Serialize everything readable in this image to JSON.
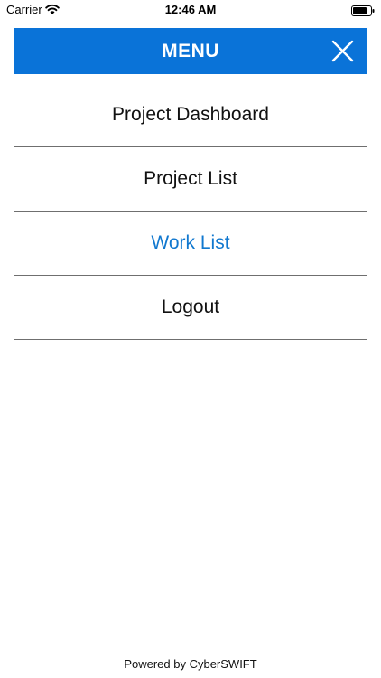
{
  "status_bar": {
    "carrier": "Carrier",
    "time": "12:46 AM",
    "wifi_icon": "wifi-icon",
    "battery_icon": "battery-icon"
  },
  "header": {
    "title": "MENU",
    "background_color": "#0a73d8",
    "close_icon": "close-icon"
  },
  "menu": {
    "items": [
      {
        "label": "Project Dashboard",
        "active": false
      },
      {
        "label": "Project List",
        "active": false
      },
      {
        "label": "Work List",
        "active": true
      },
      {
        "label": "Logout",
        "active": false
      }
    ],
    "active_color": "#1178cf"
  },
  "footer": {
    "text": "Powered by CyberSWIFT"
  }
}
